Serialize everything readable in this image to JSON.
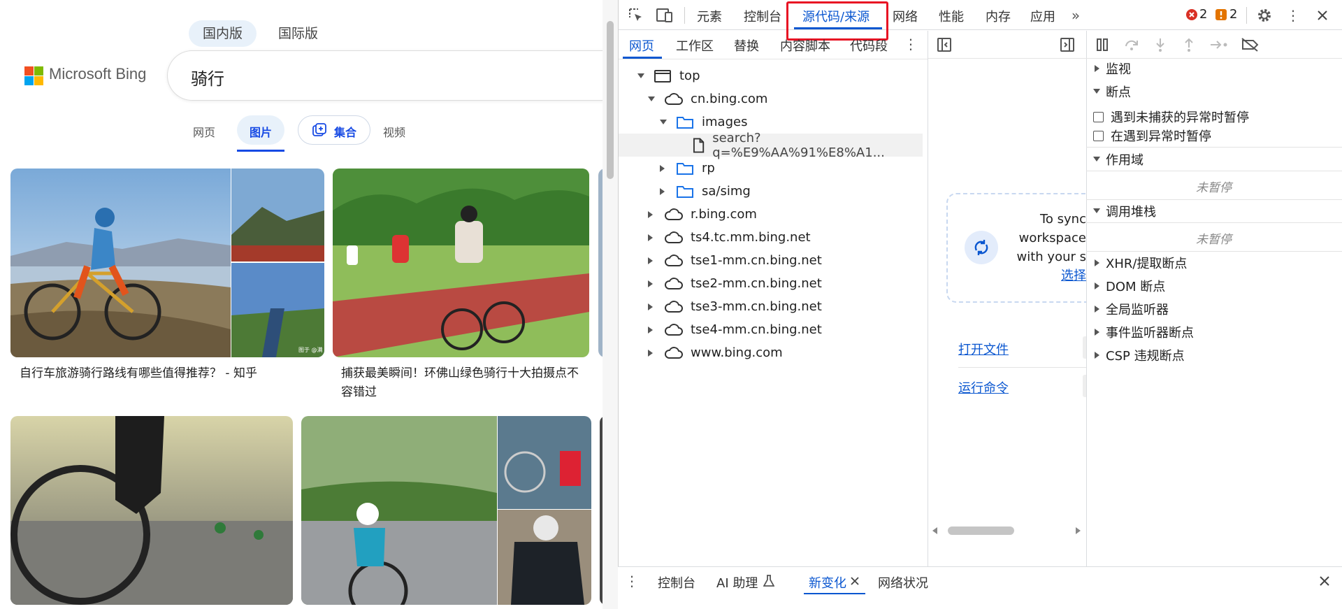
{
  "bing": {
    "version_tabs": [
      "国内版",
      "国际版"
    ],
    "logo_text": "Microsoft Bing",
    "logo_colors": [
      "#f25022",
      "#7fba00",
      "#00a4ef",
      "#ffb900"
    ],
    "query": "骑行",
    "nav": {
      "web": "网页",
      "images": "图片",
      "collections": "集合",
      "videos": "视频"
    },
    "results": [
      {
        "caption": "自行车旅游骑行路线有哪些值得推荐？ - 知乎"
      },
      {
        "caption": "捕获最美瞬间！环佛山绿色骑行十大拍摄点不容错过"
      }
    ],
    "watermark": "图于 @满"
  },
  "devtools": {
    "tabs": [
      "元素",
      "控制台",
      "源代码/来源",
      "网络",
      "性能",
      "内存",
      "应用"
    ],
    "active_tab": "源代码/来源",
    "error_count": "2",
    "warning_count": "2",
    "sub_tabs": [
      "网页",
      "工作区",
      "替换",
      "内容脚本",
      "代码段"
    ],
    "tree": {
      "top": "top",
      "domain": "cn.bing.com",
      "images": "images",
      "file": "search?q=%E9%AA%91%E8%A1...",
      "rp": "rp",
      "sasimg": "sa/simg",
      "others": [
        "r.bing.com",
        "ts4.tc.mm.bing.net",
        "tse1-mm.cn.bing.net",
        "tse2-mm.cn.bing.net",
        "tse3-mm.cn.bing.net",
        "tse4-mm.cn.bing.net",
        "www.bing.com"
      ]
    },
    "workspace": {
      "line1": "To sync",
      "line2": "workspace",
      "line3": "with your s",
      "link": "选择",
      "open_file": "打开文件",
      "run_command": "运行命令"
    },
    "right_pane": {
      "watch": "监视",
      "breakpoints": "断点",
      "pause_uncaught": "遇到未捕获的异常时暂停",
      "pause_caught": "在遇到异常时暂停",
      "scope": "作用域",
      "not_paused_1": "未暂停",
      "call_stack": "调用堆栈",
      "not_paused_2": "未暂停",
      "xhr": "XHR/提取断点",
      "dom": "DOM 断点",
      "global": "全局监听器",
      "event": "事件监听器断点",
      "csp": "CSP 违规断点"
    },
    "drawer": {
      "console": "控制台",
      "ai": "AI 助理",
      "changes": "新变化",
      "network_conditions": "网络状况"
    },
    "highlight_color": "#e81123"
  }
}
